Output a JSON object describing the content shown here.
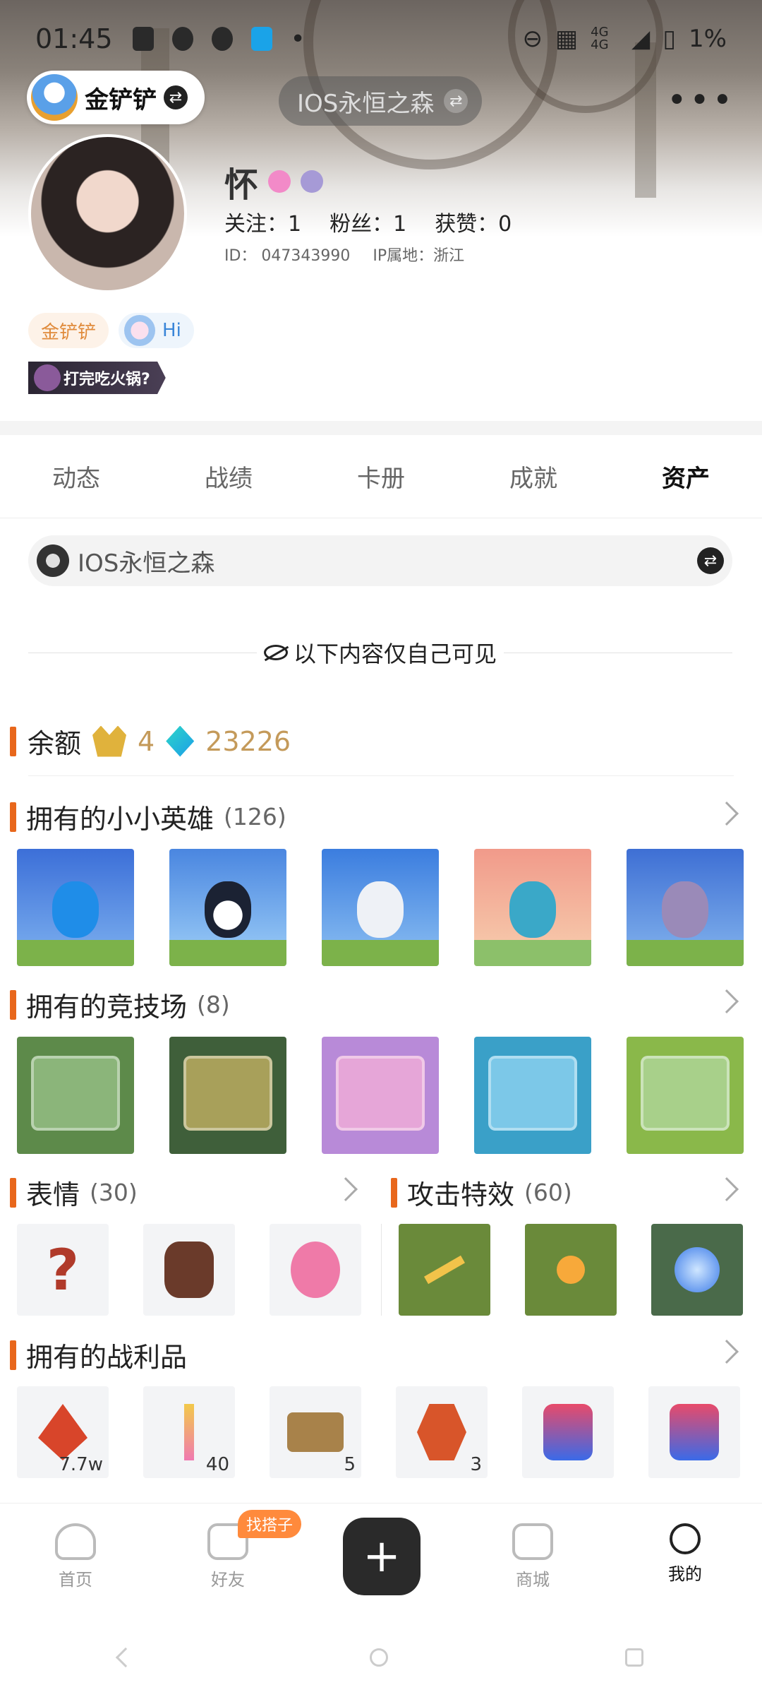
{
  "status_bar": {
    "time": "01:45",
    "network": "4G 4G",
    "battery": "1%"
  },
  "top_nav": {
    "username": "金铲铲",
    "server": "IOS永恒之森"
  },
  "profile": {
    "name": "怀",
    "following": "关注：1",
    "followers": "粉丝：1",
    "likes": "获赞：0",
    "id": "ID：  047343990",
    "ip": "IP属地：浙江",
    "tag1": "金铲铲",
    "tag2": "Hi",
    "banner": "打完吃火锅?"
  },
  "tabs": [
    "动态",
    "战绩",
    "卡册",
    "成就",
    "资产"
  ],
  "active_tab": 4,
  "server_selector": {
    "label": "IOS永恒之森"
  },
  "privacy_note": "以下内容仅自己可见",
  "balance": {
    "title": "余额",
    "crown": "4",
    "gems": "23226"
  },
  "sections": {
    "legends": {
      "title": "拥有的小小英雄",
      "count": "(126)"
    },
    "arenas": {
      "title": "拥有的竞技场",
      "count": "(8)"
    },
    "emotes": {
      "title": "表情",
      "count": "(30)"
    },
    "booms": {
      "title": "攻击特效",
      "count": "(60)"
    },
    "loot": {
      "title": "拥有的战利品"
    }
  },
  "loot_quantities": [
    "7.7w",
    "40",
    "5",
    "3"
  ],
  "bottom_nav": {
    "home": "首页",
    "friends": "好友",
    "friends_badge": "找搭子",
    "shop": "商城",
    "me": "我的"
  },
  "colors": {
    "accent": "#e8671c",
    "balance_value": "#c49a5a",
    "badge": "#ff8a3c"
  }
}
